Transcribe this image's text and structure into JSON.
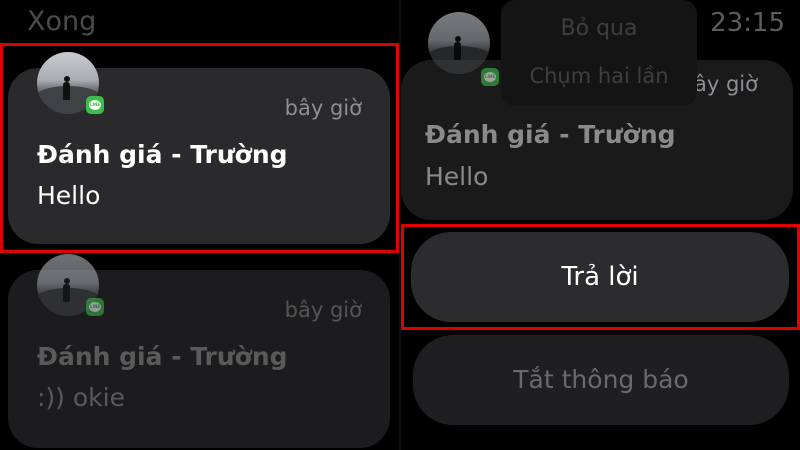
{
  "left": {
    "done_label": "Xong",
    "notifications": [
      {
        "time": "bây giờ",
        "title": "Đánh giá - Trường",
        "message": "Hello",
        "app_icon": "line-app-icon"
      },
      {
        "time": "bây giờ",
        "title": "Đánh giá - Trường",
        "message": ":)) okie",
        "app_icon": "line-app-icon"
      }
    ]
  },
  "right": {
    "clock": "23:15",
    "overlay_dismiss": "Bỏ qua",
    "overlay_hint": "Chụm hai lần",
    "notification": {
      "time": "bây giờ",
      "title": "Đánh giá - Trường",
      "message": "Hello",
      "app_icon": "line-app-icon"
    },
    "actions": {
      "reply": "Trả lời",
      "mute": "Tắt thông báo"
    }
  },
  "colors": {
    "highlight": "#e00000",
    "line_green": "#3bbf4a",
    "card": "#2a2a2c"
  }
}
